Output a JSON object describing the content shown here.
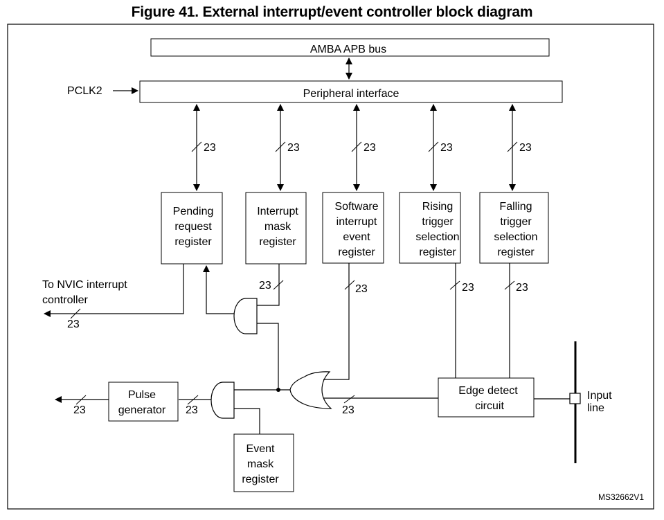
{
  "title": "Figure 41. External interrupt/event controller block diagram",
  "bus": "AMBA APB bus",
  "peripheral_interface": "Peripheral interface",
  "clock": "PCLK2",
  "bus_width": "23",
  "registers": [
    {
      "id": "pending",
      "lines": [
        "Pending",
        "request",
        "register"
      ]
    },
    {
      "id": "interrupt-mask",
      "lines": [
        "Interrupt",
        "mask",
        "register"
      ]
    },
    {
      "id": "software-interrupt-event",
      "lines": [
        "Software",
        "interrupt",
        "event",
        "register"
      ]
    },
    {
      "id": "rising-trigger",
      "lines": [
        "Rising",
        "trigger",
        "selection",
        "register"
      ]
    },
    {
      "id": "falling-trigger",
      "lines": [
        "Falling",
        "trigger",
        "selection",
        "register"
      ]
    }
  ],
  "nvic_label": [
    "To NVIC interrupt",
    "controller"
  ],
  "pulse_generator": [
    "Pulse",
    "generator"
  ],
  "event_mask": [
    "Event",
    "mask",
    "register"
  ],
  "edge_detect": [
    "Edge detect",
    "circuit"
  ],
  "input_line": [
    "Input",
    "line"
  ],
  "figure_id": "MS32662V1"
}
